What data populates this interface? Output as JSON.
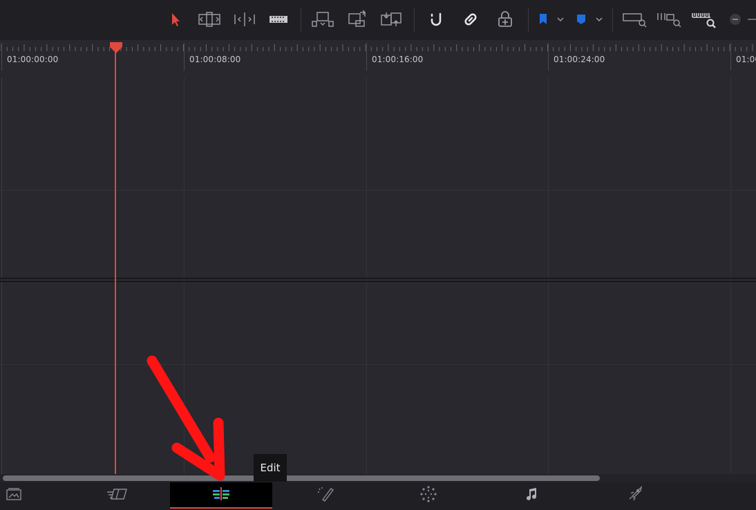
{
  "toolbar": {
    "tools": [
      {
        "name": "selection-mode-icon"
      },
      {
        "name": "trim-edit-mode-icon"
      },
      {
        "name": "dynamic-trim-mode-icon"
      },
      {
        "name": "blade-edit-mode-icon"
      },
      {
        "name": "insert-clip-icon"
      },
      {
        "name": "overwrite-clip-icon"
      },
      {
        "name": "replace-clip-icon"
      },
      {
        "name": "snapping-icon"
      },
      {
        "name": "linked-selection-icon"
      },
      {
        "name": "position-lock-icon"
      },
      {
        "name": "flag-icon"
      },
      {
        "name": "marker-icon"
      },
      {
        "name": "full-extent-zoom-icon"
      },
      {
        "name": "detail-zoom-icon"
      },
      {
        "name": "custom-zoom-icon"
      },
      {
        "name": "zoom-out-icon"
      }
    ],
    "colors": {
      "selection": "#e0493f",
      "flag": "#1e6fe0",
      "marker": "#1e6fe0"
    }
  },
  "ruler": {
    "timecodes": [
      "01:00:00:00",
      "01:00:08:00",
      "01:00:16:00",
      "01:00:24:00",
      "01:00"
    ]
  },
  "playhead": {
    "color": "#e0493f"
  },
  "tooltip": {
    "text": "Edit"
  },
  "pages": [
    {
      "name": "media-page-icon",
      "active": false
    },
    {
      "name": "cut-page-icon",
      "active": false
    },
    {
      "name": "edit-page-icon",
      "active": true
    },
    {
      "name": "fusion-page-icon",
      "active": false
    },
    {
      "name": "color-page-icon",
      "active": false
    },
    {
      "name": "fairlight-page-icon",
      "active": false
    },
    {
      "name": "deliver-page-icon",
      "active": false
    }
  ],
  "annotation": {
    "arrow_color": "#ff1414"
  }
}
